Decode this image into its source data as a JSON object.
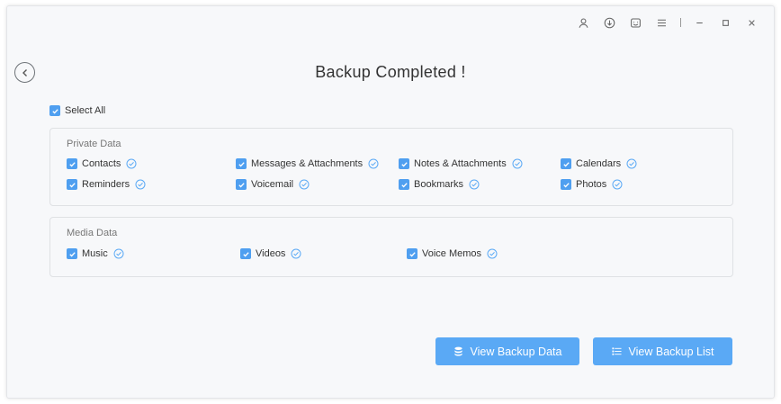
{
  "page_title": "Backup Completed !",
  "select_all_label": "Select All",
  "private_section": {
    "title": "Private Data",
    "items": [
      {
        "label": "Contacts"
      },
      {
        "label": "Messages & Attachments"
      },
      {
        "label": "Notes & Attachments"
      },
      {
        "label": "Calendars"
      },
      {
        "label": "Reminders"
      },
      {
        "label": "Voicemail"
      },
      {
        "label": "Bookmarks"
      },
      {
        "label": "Photos"
      }
    ]
  },
  "media_section": {
    "title": "Media Data",
    "items": [
      {
        "label": "Music"
      },
      {
        "label": "Videos"
      },
      {
        "label": "Voice Memos"
      }
    ]
  },
  "buttons": {
    "view_backup_data": "View Backup Data",
    "view_backup_list": "View Backup List"
  },
  "icons": {
    "titlebar": [
      "account-icon",
      "download-icon",
      "feedback-icon",
      "menu-icon",
      "minimize-icon",
      "maximize-icon",
      "close-icon"
    ],
    "back": "back-arrow-icon",
    "checkbox": "checkbox-checked-icon",
    "status": "check-circle-icon"
  },
  "colors": {
    "accent": "#5aa9f5",
    "checkbox": "#4f9ff0",
    "status_check": "#5aa9f5"
  }
}
